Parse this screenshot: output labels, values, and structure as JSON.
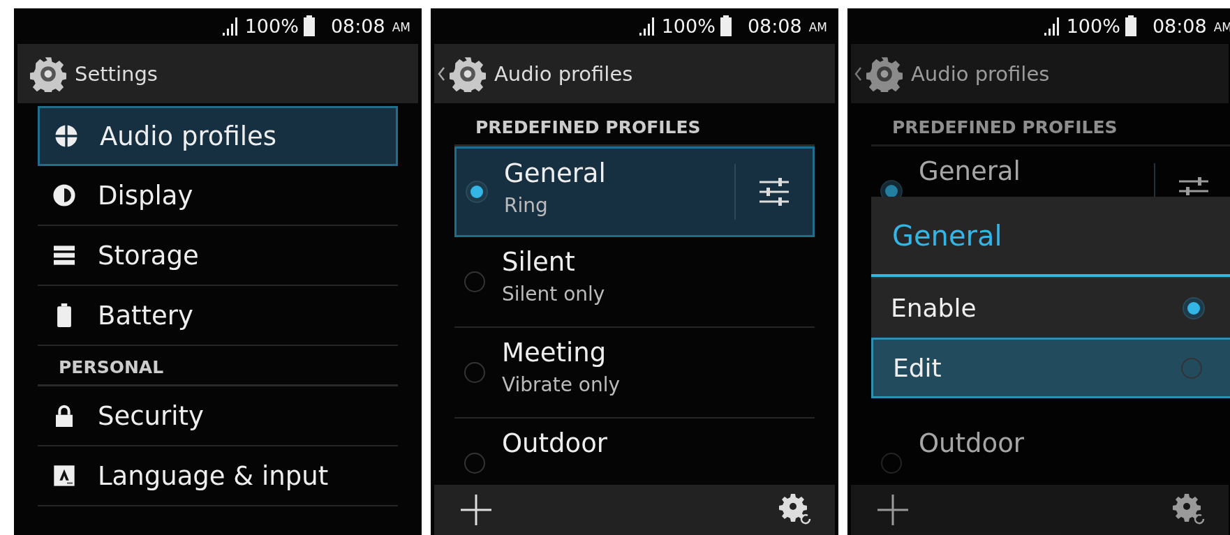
{
  "screens": [
    {
      "status_bar": {
        "battery": "100%",
        "time": "08:08",
        "meridiem": "AM"
      },
      "action_bar": {
        "title": "Settings",
        "back": false
      },
      "bottom_bar": false,
      "items": [
        {
          "kind": "setting",
          "label": "Audio profiles",
          "selected": true
        },
        {
          "kind": "setting",
          "label": "Display",
          "selected": false
        },
        {
          "kind": "setting",
          "label": "Storage",
          "selected": false
        },
        {
          "kind": "setting",
          "label": "Battery",
          "selected": false
        },
        {
          "kind": "header",
          "label": "PERSONAL"
        },
        {
          "kind": "setting",
          "label": "Security",
          "selected": false
        },
        {
          "kind": "setting",
          "label": "Language & input",
          "selected": false
        }
      ]
    },
    {
      "status_bar": {
        "battery": "100%",
        "time": "08:08",
        "meridiem": "AM"
      },
      "action_bar": {
        "title": "Audio profiles",
        "back": true
      },
      "bottom_bar": true,
      "items": [
        {
          "kind": "header",
          "label": "PREDEFINED PROFILES"
        },
        {
          "kind": "profile",
          "title": "General",
          "subtitle": "Ring",
          "checked": true,
          "selected": true,
          "settings_button": true
        },
        {
          "kind": "profile",
          "title": "Silent",
          "subtitle": "Silent only",
          "checked": false,
          "selected": false,
          "settings_button": false
        },
        {
          "kind": "profile",
          "title": "Meeting",
          "subtitle": "Vibrate only",
          "checked": false,
          "selected": false,
          "settings_button": false
        },
        {
          "kind": "profile",
          "title": "Outdoor",
          "checked": false,
          "selected": false,
          "settings_button": false
        }
      ]
    },
    {
      "status_bar": {
        "battery": "100%",
        "time": "08:08",
        "meridiem": "AM"
      },
      "action_bar": {
        "title": "Audio profiles",
        "back": true
      },
      "bottom_bar": true,
      "items": [
        {
          "kind": "header",
          "label": "PREDEFINED PROFILES"
        },
        {
          "kind": "profile",
          "title": "General",
          "checked": true,
          "selected": false,
          "settings_button": true
        },
        {
          "kind": "covered"
        },
        {
          "kind": "covered"
        },
        {
          "kind": "profile",
          "title": "Outdoor",
          "checked": false,
          "selected": false,
          "settings_button": false
        }
      ],
      "dialog": {
        "title": "General",
        "options": [
          {
            "label": "Enable",
            "checked": true,
            "selected": false
          },
          {
            "label": "Edit",
            "checked": false,
            "selected": true
          }
        ]
      }
    }
  ]
}
